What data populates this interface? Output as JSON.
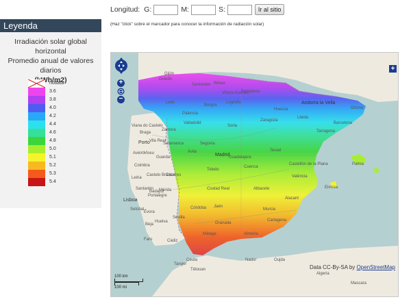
{
  "form": {
    "longitude_label": "Longitud:",
    "g_label": "G:",
    "m_label": "M:",
    "s_label": "S:",
    "go_button_label": "Ir al sitio",
    "hint": "(Haz \"click\" sobre el marcador para conocer la información de radiación solar)"
  },
  "legend": {
    "header": "Leyenda",
    "description_line1": "Irradiación solar global horizontal",
    "description_line2": "Promedio anual de valores",
    "description_line3": "diarios",
    "unit": "(kWh/m2)",
    "nodata_label": "nodata",
    "scale": [
      {
        "label": "3.6",
        "color": "#ee44ee"
      },
      {
        "label": "3.8",
        "color": "#b040f0"
      },
      {
        "label": "4.0",
        "color": "#4f5cf2"
      },
      {
        "label": "4.2",
        "color": "#28a8f8"
      },
      {
        "label": "4.4",
        "color": "#2ce0ee"
      },
      {
        "label": "4.6",
        "color": "#34e09a"
      },
      {
        "label": "4.8",
        "color": "#3cd63c"
      },
      {
        "label": "5.0",
        "color": "#a8ee2c"
      },
      {
        "label": "5.1",
        "color": "#f4f42a"
      },
      {
        "label": "5.2",
        "color": "#f8b820"
      },
      {
        "label": "5.3",
        "color": "#f45a1c"
      },
      {
        "label": "5.4",
        "color": "#c81414"
      }
    ]
  },
  "map": {
    "attribution_prefix": "Data CC-By-SA by",
    "attribution_link": "OpenStreetMap",
    "scale_km": "100 km",
    "scale_mi": "100 mi",
    "layer_switch_symbol": "+",
    "zoom_in_symbol": "+",
    "zoom_out_symbol": "−",
    "cities": [
      {
        "name": "Santander",
        "big": false
      },
      {
        "name": "Bilbao",
        "big": false
      },
      {
        "name": "Vitoria-Gasteiz",
        "big": false
      },
      {
        "name": "Oviedo",
        "big": false
      },
      {
        "name": "Gijón",
        "big": false
      },
      {
        "name": "León",
        "big": false
      },
      {
        "name": "Burgos",
        "big": false
      },
      {
        "name": "Logroño",
        "big": false
      },
      {
        "name": "Pamplona",
        "big": false
      },
      {
        "name": "Andorra la Vella",
        "big": true
      },
      {
        "name": "Girona",
        "big": false
      },
      {
        "name": "Barcelona",
        "big": false
      },
      {
        "name": "Tarragona",
        "big": false
      },
      {
        "name": "Lleida",
        "big": false
      },
      {
        "name": "Zaragoza",
        "big": false
      },
      {
        "name": "Huesca",
        "big": false
      },
      {
        "name": "Soria",
        "big": false
      },
      {
        "name": "Valladolid",
        "big": false
      },
      {
        "name": "Palencia",
        "big": false
      },
      {
        "name": "Zamora",
        "big": false
      },
      {
        "name": "Salamanca",
        "big": false
      },
      {
        "name": "Segovia",
        "big": false
      },
      {
        "name": "Ávila",
        "big": false
      },
      {
        "name": "Madrid",
        "big": true
      },
      {
        "name": "Guadalajara",
        "big": false
      },
      {
        "name": "Cuenca",
        "big": false
      },
      {
        "name": "Teruel",
        "big": false
      },
      {
        "name": "Castellón de la Plana",
        "big": false
      },
      {
        "name": "València",
        "big": false
      },
      {
        "name": "Toledo",
        "big": false
      },
      {
        "name": "Cáceres",
        "big": false
      },
      {
        "name": "Mérida",
        "big": false
      },
      {
        "name": "Badajoz",
        "big": false
      },
      {
        "name": "Ciudad Real",
        "big": false
      },
      {
        "name": "Albacete",
        "big": false
      },
      {
        "name": "Alacant",
        "big": false
      },
      {
        "name": "Murcia",
        "big": false
      },
      {
        "name": "Cartagena",
        "big": false
      },
      {
        "name": "Jaén",
        "big": false
      },
      {
        "name": "Córdoba",
        "big": false
      },
      {
        "name": "Sevilla",
        "big": false
      },
      {
        "name": "Huelva",
        "big": false
      },
      {
        "name": "Granada",
        "big": false
      },
      {
        "name": "Almería",
        "big": false
      },
      {
        "name": "Málaga",
        "big": false
      },
      {
        "name": "Cádiz",
        "big": false
      },
      {
        "name": "Ceuta",
        "big": false
      },
      {
        "name": "Tanger",
        "big": false
      },
      {
        "name": "Tétouan",
        "big": false
      },
      {
        "name": "Nador",
        "big": false
      },
      {
        "name": "Oujda",
        "big": false
      },
      {
        "name": "Palma",
        "big": false
      },
      {
        "name": "Eivissa",
        "big": false
      },
      {
        "name": "Viana do Castelo",
        "big": false
      },
      {
        "name": "Braga",
        "big": false
      },
      {
        "name": "Porto",
        "big": true
      },
      {
        "name": "Vila Real",
        "big": false
      },
      {
        "name": "Viseu",
        "big": false
      },
      {
        "name": "Aveiro",
        "big": false
      },
      {
        "name": "Guarda",
        "big": false
      },
      {
        "name": "Coimbra",
        "big": false
      },
      {
        "name": "Castelo Branco",
        "big": false
      },
      {
        "name": "Leiria",
        "big": false
      },
      {
        "name": "Santarém",
        "big": false
      },
      {
        "name": "Portalegre",
        "big": false
      },
      {
        "name": "Lisboa",
        "big": true
      },
      {
        "name": "Setúbal",
        "big": false
      },
      {
        "name": "Évora",
        "big": false
      },
      {
        "name": "Beja",
        "big": false
      },
      {
        "name": "Faro",
        "big": false
      },
      {
        "name": "Algeria",
        "big": false
      },
      {
        "name": "Mascara",
        "big": false
      }
    ]
  }
}
